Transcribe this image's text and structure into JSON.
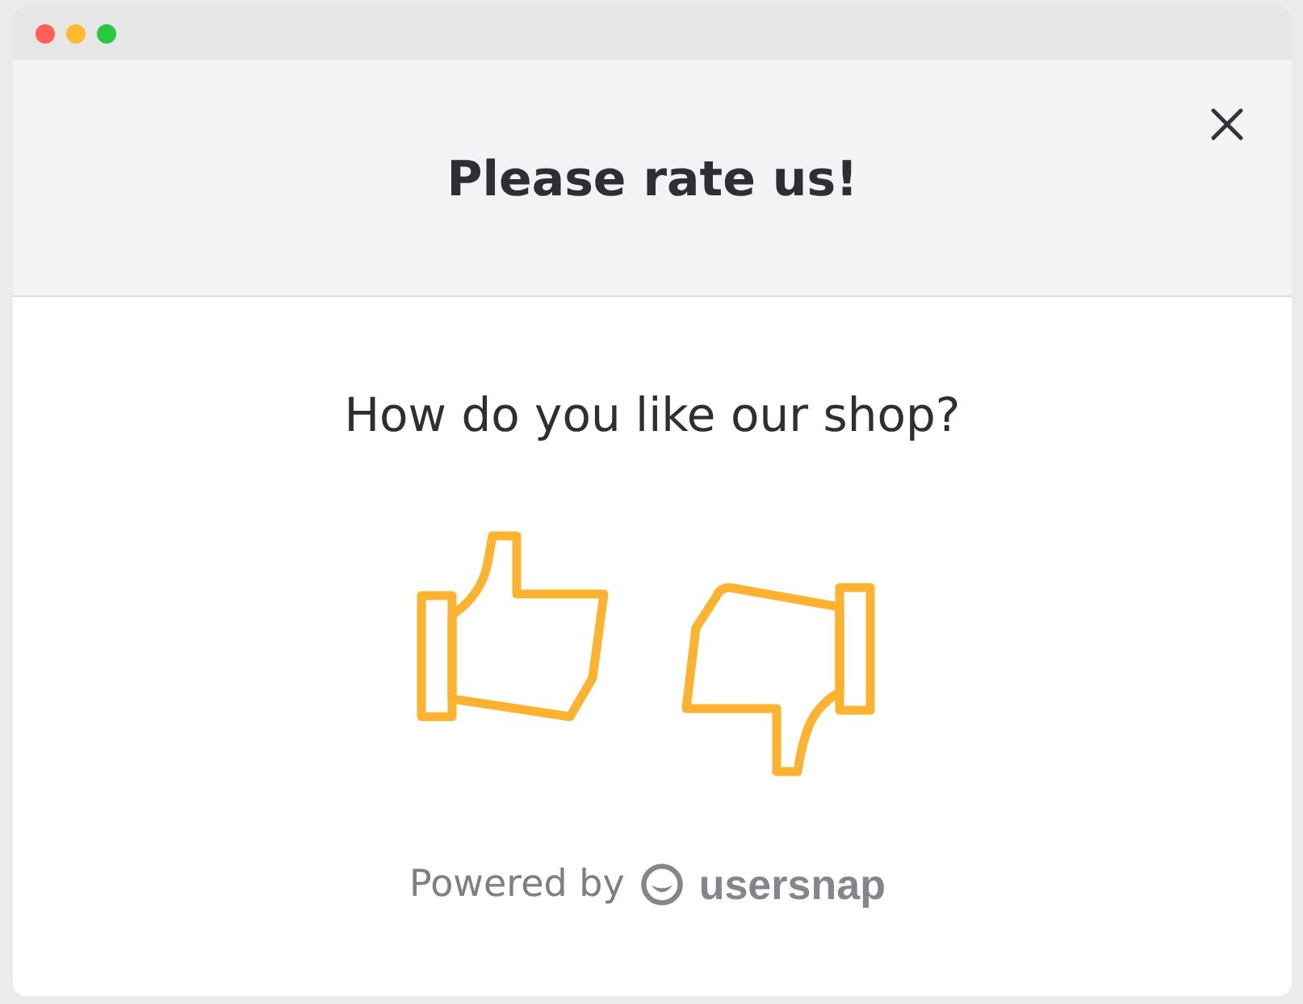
{
  "window": {
    "controls": [
      {
        "color": "#fe5f57"
      },
      {
        "color": "#febb2e"
      },
      {
        "color": "#28c840"
      }
    ]
  },
  "dialog": {
    "title": "Please rate us!",
    "question": "How do you like our shop?",
    "options": [
      {
        "kind": "thumbs_up"
      },
      {
        "kind": "thumbs_down"
      }
    ],
    "footer": {
      "label": "Powered by",
      "brand": "usersnap"
    }
  }
}
